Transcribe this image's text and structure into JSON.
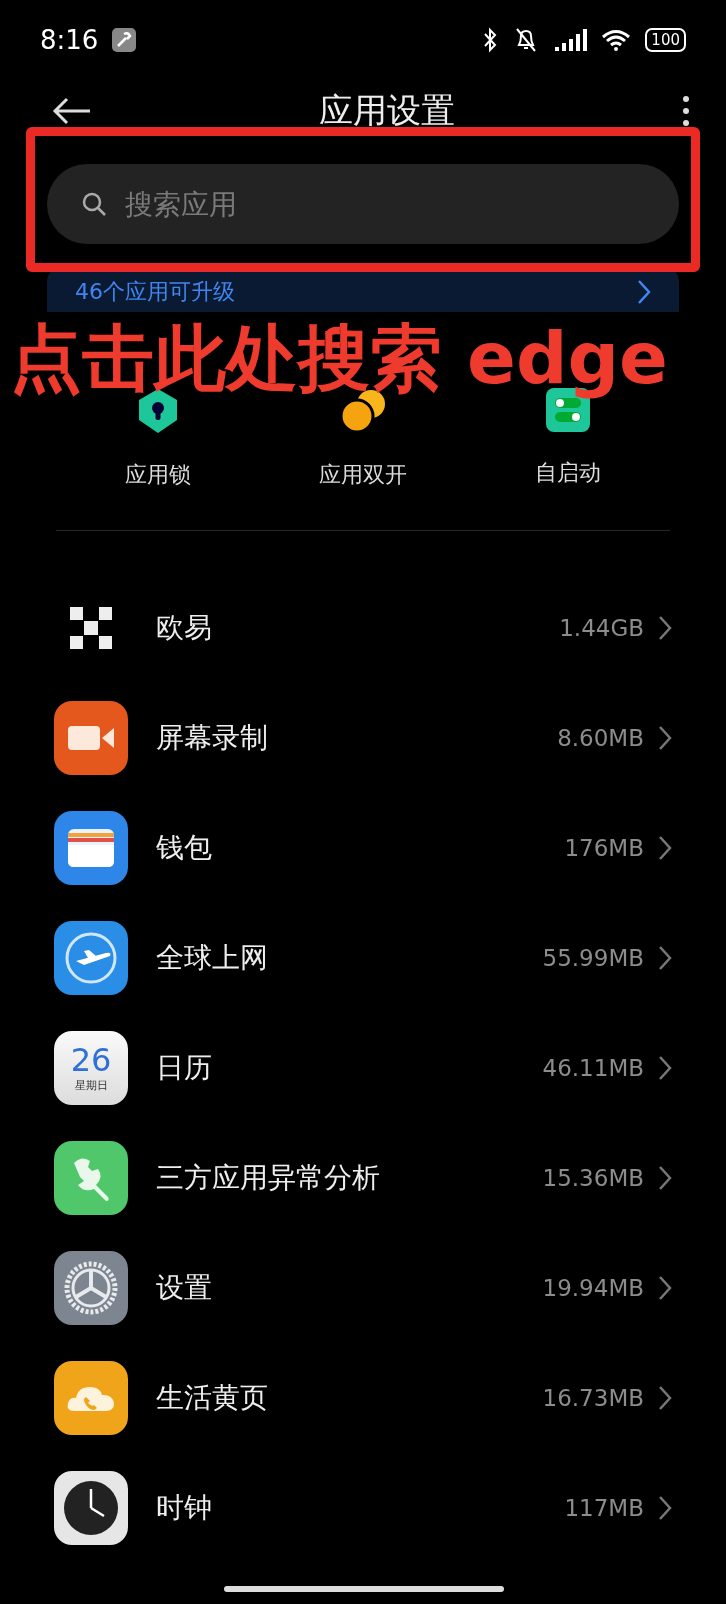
{
  "status_bar": {
    "time": "8:16",
    "battery": "100"
  },
  "header": {
    "title": "应用设置"
  },
  "search": {
    "placeholder": "搜索应用"
  },
  "banner": {
    "text": "46个应用可升级"
  },
  "annotation": {
    "text": "点击此处搜索 edge"
  },
  "quick_actions": [
    {
      "kind": "lock",
      "label": "应用锁"
    },
    {
      "kind": "dual",
      "label": "应用双开"
    },
    {
      "kind": "autostart",
      "label": "自启动"
    }
  ],
  "apps": [
    {
      "kind": "okx",
      "name": "欧易",
      "size": "1.44GB"
    },
    {
      "kind": "recorder",
      "name": "屏幕录制",
      "size": "8.60MB"
    },
    {
      "kind": "wallet",
      "name": "钱包",
      "size": "176MB"
    },
    {
      "kind": "travel",
      "name": "全球上网",
      "size": "55.99MB"
    },
    {
      "kind": "calendar",
      "name": "日历",
      "size": "46.11MB",
      "icon_text": [
        "26",
        "星期日"
      ]
    },
    {
      "kind": "tool",
      "name": "三方应用异常分析",
      "size": "15.36MB"
    },
    {
      "kind": "settings",
      "name": "设置",
      "size": "19.94MB"
    },
    {
      "kind": "yellowpage",
      "name": "生活黄页",
      "size": "16.73MB"
    },
    {
      "kind": "clock",
      "name": "时钟",
      "size": "117MB"
    }
  ]
}
